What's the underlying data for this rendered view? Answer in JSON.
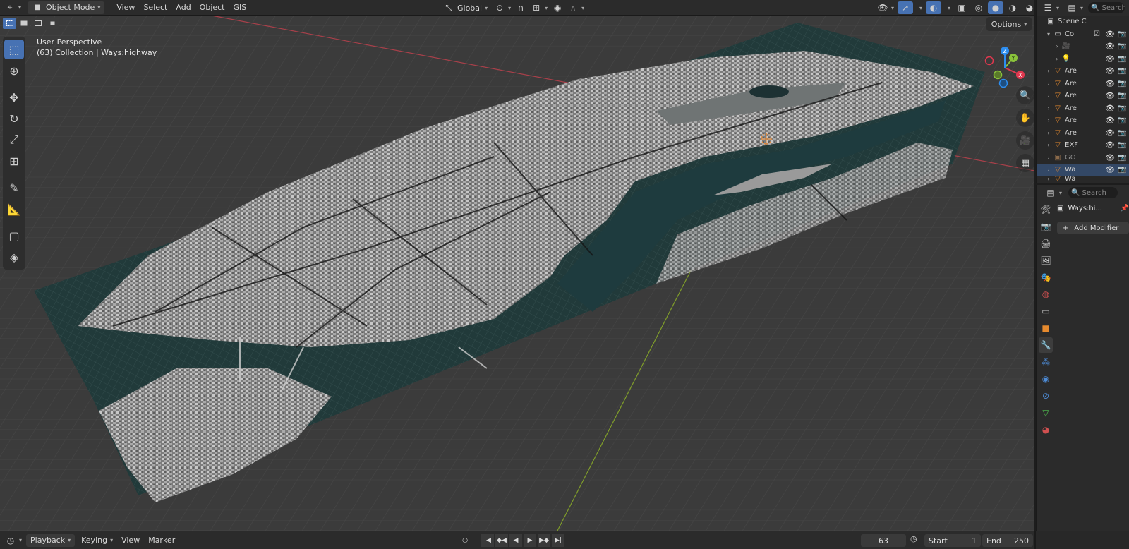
{
  "header": {
    "editor_icon": "editor-type-icon",
    "mode": "Object Mode",
    "menus": [
      "View",
      "Select",
      "Add",
      "Object",
      "GIS"
    ],
    "transform_orientation": "Global",
    "options_label": "Options"
  },
  "viewport": {
    "view_name": "User Perspective",
    "collection_info": "(63) Collection | Ways:highway",
    "gizmo_axes": [
      "X",
      "Y",
      "Z"
    ]
  },
  "toolbar": {
    "tools": [
      "select-box-icon",
      "cursor-icon",
      "move-icon",
      "rotate-icon",
      "scale-icon",
      "transform-icon",
      "annotate-icon",
      "measure-icon",
      "add-cube-icon",
      "add-mesh-icon"
    ]
  },
  "outliner": {
    "search_placeholder": "Search",
    "scene_label": "Scene C",
    "rows": [
      {
        "name": "Coll",
        "type": "collection",
        "expanded": true
      },
      {
        "name": "",
        "type": "camera"
      },
      {
        "name": "",
        "type": "light"
      },
      {
        "name": "Are",
        "type": "mesh"
      },
      {
        "name": "Are",
        "type": "mesh"
      },
      {
        "name": "Are",
        "type": "mesh"
      },
      {
        "name": "Are",
        "type": "mesh"
      },
      {
        "name": "Are",
        "type": "mesh"
      },
      {
        "name": "Are",
        "type": "mesh"
      },
      {
        "name": "EXF",
        "type": "mesh"
      },
      {
        "name": "GO",
        "type": "mesh-dim"
      },
      {
        "name": "Wa",
        "type": "mesh"
      },
      {
        "name": "Wa",
        "type": "mesh"
      }
    ]
  },
  "properties": {
    "search_placeholder": "Search",
    "object_name": "Ways:hi...",
    "add_modifier_label": "Add Modifier"
  },
  "timeline": {
    "menus": [
      "Playback",
      "Keying",
      "View",
      "Marker"
    ],
    "current_frame": "63",
    "start_label": "Start",
    "start_value": "1",
    "end_label": "End",
    "end_value": "250"
  },
  "colors": {
    "accent": "#4772b3",
    "x_axis": "#e0384f",
    "y_axis": "#8ac33b",
    "z_axis": "#2d8ef0",
    "water": "#1f3334"
  }
}
